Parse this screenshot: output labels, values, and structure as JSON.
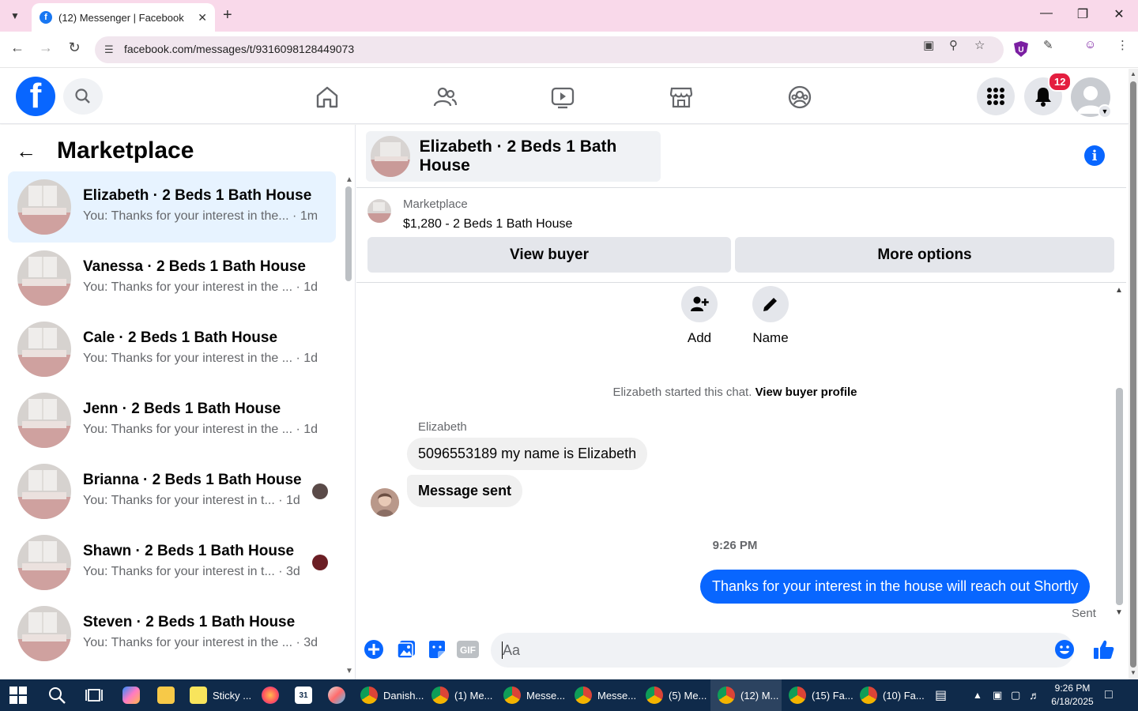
{
  "browser": {
    "tab_title": "(12) Messenger | Facebook",
    "url": "facebook.com/messages/t/9316098128449073"
  },
  "header": {
    "notification_count": "12"
  },
  "sidebar": {
    "title": "Marketplace",
    "conversations": [
      {
        "name": "Elizabeth · 2 Beds 1 Bath House",
        "snippet": "You: Thanks for your interest in the...",
        "time": "· 1m",
        "active": true
      },
      {
        "name": "Vanessa · 2 Beds 1 Bath House",
        "snippet": "You: Thanks for your interest in the ...",
        "time": "· 1d"
      },
      {
        "name": "Cale · 2 Beds 1 Bath House",
        "snippet": "You: Thanks for your interest in the ...",
        "time": "· 1d"
      },
      {
        "name": "Jenn · 2 Beds 1 Bath House",
        "snippet": "You: Thanks for your interest in the ...",
        "time": "· 1d"
      },
      {
        "name": "Brianna · 2 Beds 1 Bath House",
        "snippet": "You: Thanks for your interest in t...",
        "time": "· 1d"
      },
      {
        "name": "Shawn · 2 Beds 1 Bath House",
        "snippet": "You: Thanks for your interest in t...",
        "time": "· 3d"
      },
      {
        "name": "Steven · 2 Beds 1 Bath House",
        "snippet": "You: Thanks for your interest in the ...",
        "time": "· 3d"
      }
    ]
  },
  "chat": {
    "title": "Elizabeth · 2 Beds 1 Bath House",
    "listing_label": "Marketplace",
    "listing_price": "$1,280 - 2 Beds 1 Bath House",
    "view_buyer": "View buyer",
    "more_options": "More options",
    "add_label": "Add",
    "name_label": "Name",
    "started_text": "Elizabeth started this chat.",
    "view_profile": "View buyer profile",
    "sender_name": "Elizabeth",
    "incoming": [
      "5096553189 my name is Elizabeth",
      "Message sent"
    ],
    "timestamp": "9:26 PM",
    "outgoing": "Thanks for your interest in the house will reach out Shortly",
    "status": "Sent",
    "composer_placeholder": "Aa"
  },
  "taskbar": {
    "items": [
      "Sticky ...",
      "Danish...",
      "(1) Me...",
      "Messe...",
      "Messe...",
      "(5) Me...",
      "(12) M...",
      "(15) Fa...",
      "(10) Fa..."
    ],
    "time": "9:26 PM",
    "date": "6/18/2025"
  },
  "colors": {
    "brand": "#0866ff",
    "tabstrip": "#f9d9ea",
    "active_row": "#e7f3ff",
    "taskbar": "#0f2a4a"
  }
}
